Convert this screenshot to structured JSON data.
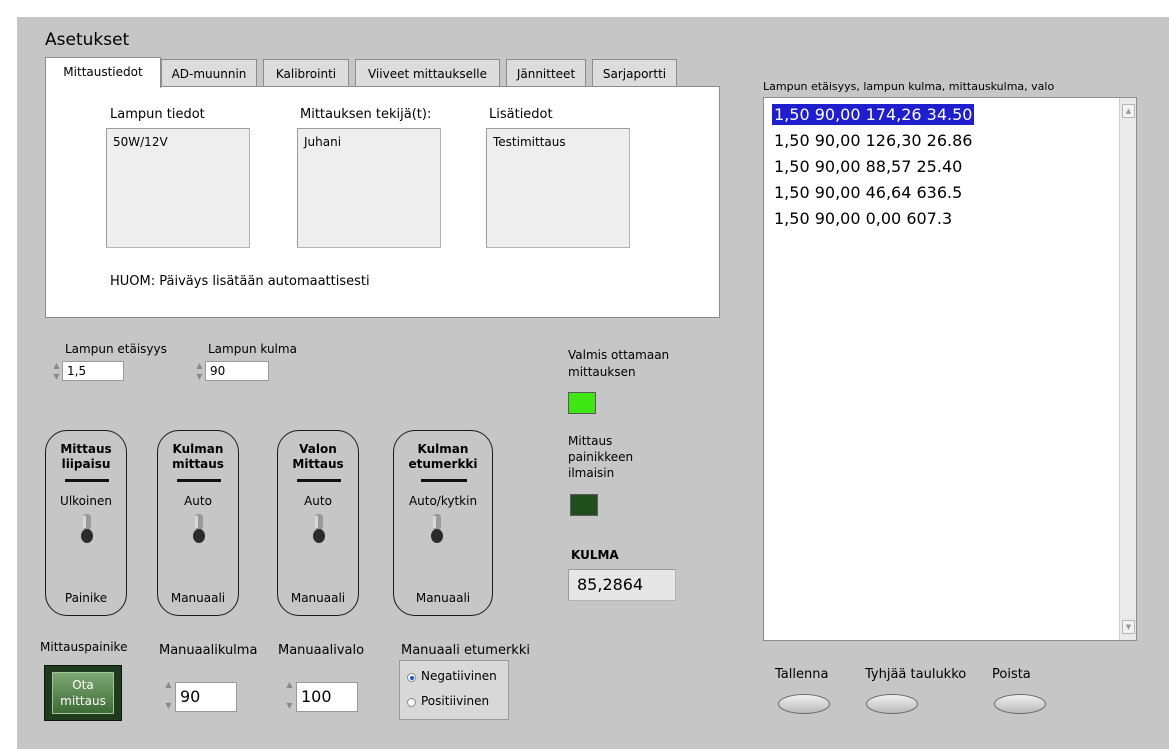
{
  "settings": {
    "title": "Asetukset",
    "tabs": [
      "Mittaustiedot",
      "AD-muunnin",
      "Kalibrointi",
      "Viiveet mittaukselle",
      "Jännitteet",
      "Sarjaportti"
    ],
    "lamp_info": {
      "label": "Lampun tiedot",
      "value": "50W/12V"
    },
    "measurer": {
      "label": "Mittauksen tekijä(t):",
      "value": "Juhani"
    },
    "extra": {
      "label": "Lisätiedot",
      "value": "Testimittaus"
    },
    "note": "HUOM: Päiväys lisätään automaattisesti"
  },
  "controls": {
    "lamp_distance": {
      "label": "Lampun etäisyys",
      "value": "1,5"
    },
    "lamp_angle": {
      "label": "Lampun kulma",
      "value": "90"
    }
  },
  "switches": [
    {
      "title_line1": "Mittaus",
      "title_line2": "liipaisu",
      "top": "Ulkoinen",
      "bottom": "Painike"
    },
    {
      "title_line1": "Kulman",
      "title_line2": "mittaus",
      "top": "Auto",
      "bottom": "Manuaali"
    },
    {
      "title_line1": "Valon",
      "title_line2": "Mittaus",
      "top": "Auto",
      "bottom": "Manuaali"
    },
    {
      "title_line1": "Kulman",
      "title_line2": "etumerkki",
      "top": "Auto/kytkin",
      "bottom": "Manuaali"
    }
  ],
  "indicators": {
    "ready": {
      "label_line1": "Valmis ottamaan",
      "label_line2": "mittauksen",
      "color": "#3ee614"
    },
    "button_led": {
      "label_line1": "Mittaus",
      "label_line2": "painikkeen",
      "label_line3": "ilmaisin",
      "color": "#1f4d1c"
    },
    "angle": {
      "label": "KULMA",
      "value": "85,2864"
    }
  },
  "bottom": {
    "measure_button_label": "Mittauspainike",
    "measure_button_text_line1": "Ota",
    "measure_button_text_line2": "mittaus",
    "manual_angle": {
      "label": "Manuaalikulma",
      "value": "90"
    },
    "manual_light": {
      "label": "Manuaalivalo",
      "value": "100"
    },
    "manual_sign": {
      "label": "Manuaali etumerkki",
      "options": [
        "Negatiivinen",
        "Positiivinen"
      ],
      "selected": "Negatiivinen"
    }
  },
  "results": {
    "header": "Lampun etäisyys, lampun kulma, mittauskulma, valo",
    "rows": [
      "1,50 90,00 174,26 34.50",
      "1,50 90,00 126,30 26.86",
      "1,50 90,00 88,57 25.40",
      "1,50 90,00 46,64 636.5",
      "1,50 90,00 0,00 607.3"
    ],
    "buttons": [
      "Tallenna",
      "Tyhjää taulukko",
      "Poista"
    ]
  }
}
